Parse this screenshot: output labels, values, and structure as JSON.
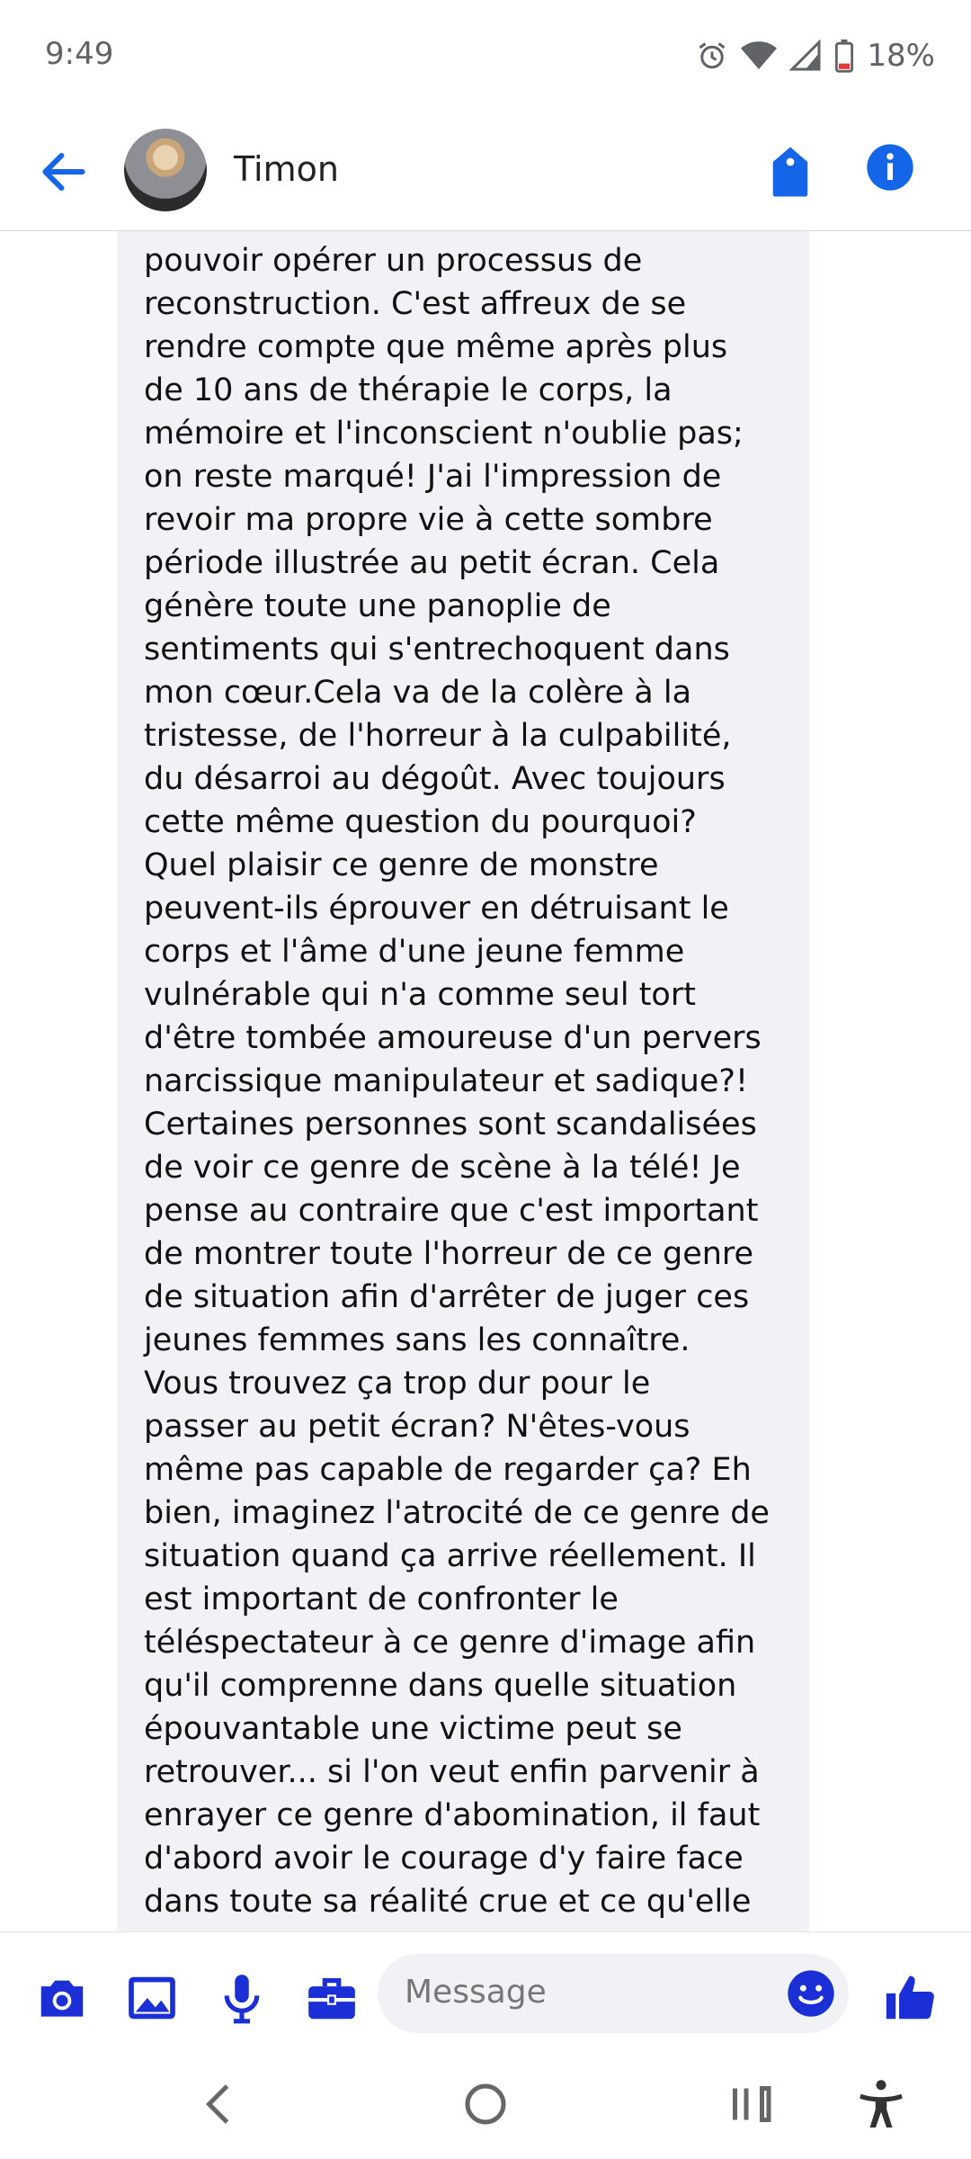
{
  "status": {
    "time": "9:49",
    "battery": "18%"
  },
  "header": {
    "contact_name": "Timon"
  },
  "message": {
    "text": "pouvoir opérer un processus de\nreconstruction. C'est affreux de se\nrendre compte que même après plus\nde 10 ans de thérapie le corps, la\nmémoire et l'inconscient n'oublie pas;\non reste marqué! J'ai l'impression de\nrevoir ma propre vie à cette sombre\npériode illustrée au petit écran. Cela\ngénère toute une panoplie de\nsentiments qui s'entrechoquent dans\nmon cœur.Cela va de la colère à la\ntristesse, de l'horreur à la culpabilité,\ndu désarroi au dégoût. Avec toujours\ncette même question du pourquoi?\nQuel plaisir ce genre de monstre\npeuvent-ils éprouver en détruisant le\ncorps et l'âme d'une jeune femme\nvulnérable qui n'a comme seul tort\nd'être tombée amoureuse d'un pervers\nnarcissique manipulateur et sadique?!\nCertaines personnes sont scandalisées\nde voir ce genre de scène à la télé!  Je\npense au contraire que c'est important\nde montrer toute l'horreur de ce genre\nde situation afin d'arrêter de juger ces\njeunes femmes sans les connaître.\nVous trouvez ça trop dur pour le\npasser au petit écran? N'êtes-vous\nmême pas capable de regarder ça? Eh\nbien, imaginez  l'atrocité de ce genre de\nsituation quand ça arrive réellement. Il\nest important de confronter le\ntéléspectateur à ce genre d'image afin\nqu'il comprenne dans quelle situation\népouvantable une victime peut se\nretrouver... si l'on veut enfin parvenir à\nenrayer ce genre d'abomination, il faut\nd'abord avoir le courage d'y faire face\ndans toute sa réalité crue et ce qu'elle"
  },
  "composer": {
    "placeholder": "Message"
  },
  "colors": {
    "accent": "#1565e8",
    "bubble": "#f1f2f6",
    "composer_icons": "#1a2fd6"
  },
  "icons": {
    "back": "arrow-left-icon",
    "tag": "tag-icon",
    "info": "info-icon",
    "camera": "camera-icon",
    "gallery": "image-icon",
    "mic": "microphone-icon",
    "briefcase": "briefcase-icon",
    "emoji": "emoji-icon",
    "like": "thumbs-up-icon"
  }
}
